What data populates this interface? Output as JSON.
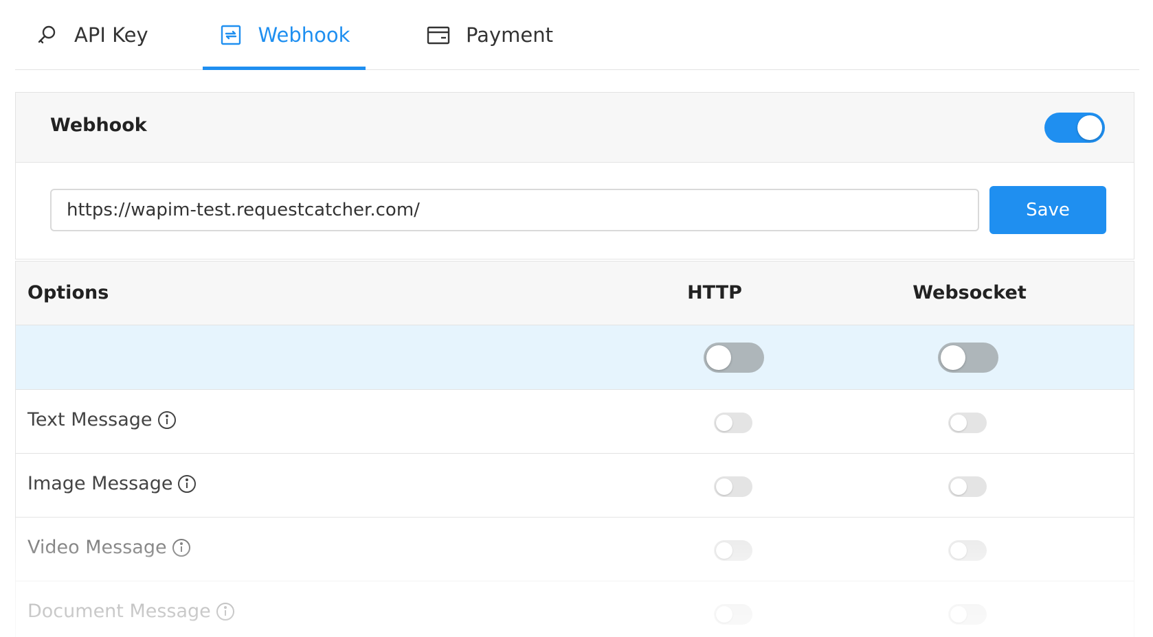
{
  "tabs": [
    {
      "label": "API Key",
      "icon": "key-icon",
      "active": false
    },
    {
      "label": "Webhook",
      "icon": "webhook-icon",
      "active": true
    },
    {
      "label": "Payment",
      "icon": "card-icon",
      "active": false
    }
  ],
  "webhook": {
    "title": "Webhook",
    "enabled": true,
    "url_value": "https://wapim-test.requestcatcher.com/",
    "save_label": "Save"
  },
  "options": {
    "headers": {
      "options": "Options",
      "http": "HTTP",
      "websocket": "Websocket"
    },
    "master": {
      "http": false,
      "websocket": false
    },
    "rows": [
      {
        "label": "Text Message",
        "http": false,
        "websocket": false
      },
      {
        "label": "Image Message",
        "http": false,
        "websocket": false
      },
      {
        "label": "Video Message",
        "http": false,
        "websocket": false
      },
      {
        "label": "Document Message",
        "http": false,
        "websocket": false
      }
    ]
  },
  "colors": {
    "accent": "#1f8ff0",
    "master_row_bg": "#e6f4fd",
    "switch_off": "#aeb6ba"
  }
}
